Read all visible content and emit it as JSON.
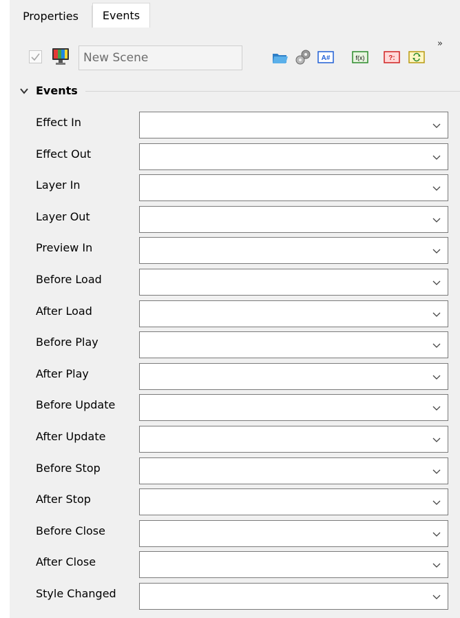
{
  "tabs": [
    {
      "label": "Properties",
      "active": false
    },
    {
      "label": "Events",
      "active": true
    }
  ],
  "toolbar": {
    "enabled_checked": true,
    "scene_name": "New Scene",
    "icons": [
      "scene-icon",
      "folder-icon",
      "gears-icon",
      "text-icon",
      "function-icon",
      "question-icon",
      "refresh-icon"
    ],
    "more_label": "»"
  },
  "section": {
    "title": "Events",
    "expanded": true
  },
  "events": [
    {
      "label": "Effect In",
      "value": ""
    },
    {
      "label": "Effect Out",
      "value": ""
    },
    {
      "label": "Layer In",
      "value": ""
    },
    {
      "label": "Layer Out",
      "value": ""
    },
    {
      "label": "Preview In",
      "value": ""
    },
    {
      "label": "Before Load",
      "value": ""
    },
    {
      "label": "After Load",
      "value": ""
    },
    {
      "label": "Before Play",
      "value": ""
    },
    {
      "label": "After Play",
      "value": ""
    },
    {
      "label": "Before Update",
      "value": ""
    },
    {
      "label": "After Update",
      "value": ""
    },
    {
      "label": "Before Stop",
      "value": ""
    },
    {
      "label": "After Stop",
      "value": ""
    },
    {
      "label": "Before Close",
      "value": ""
    },
    {
      "label": "After Close",
      "value": ""
    },
    {
      "label": "Style Changed",
      "value": ""
    }
  ],
  "colors": {
    "panel_bg": "#f0f0f0",
    "field_border": "#7a7a7a",
    "text_icon_blue": "#1f5fd6",
    "function_icon_green": "#2a8a2a",
    "question_icon_red": "#d02020",
    "refresh_icon_yellow": "#f2d64a"
  }
}
